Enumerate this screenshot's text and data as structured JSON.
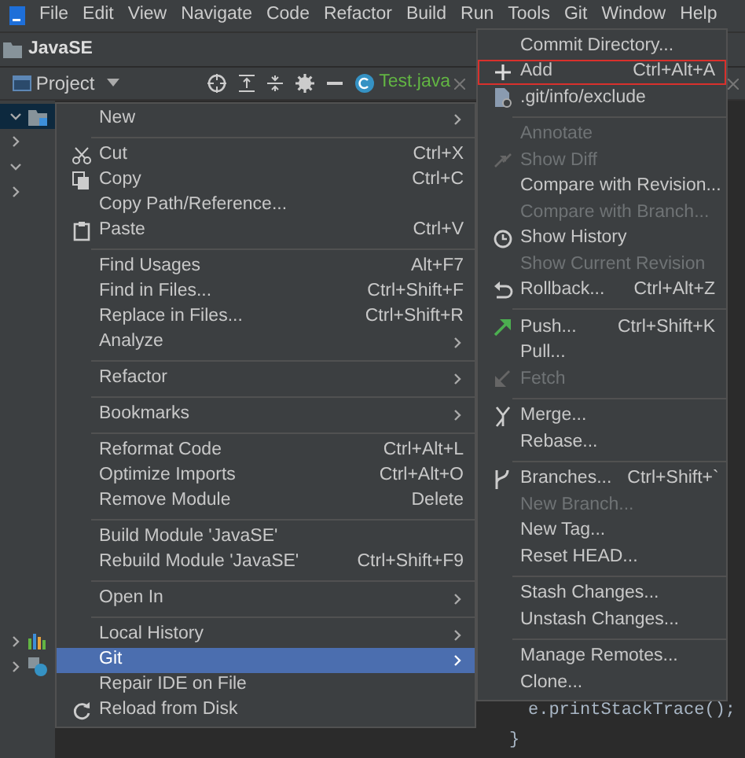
{
  "menu_bar": [
    "File",
    "Edit",
    "View",
    "Navigate",
    "Code",
    "Refactor",
    "Build",
    "Run",
    "Tools",
    "Git",
    "Window",
    "Help"
  ],
  "project_title": "JavaSE",
  "tool_window": {
    "title": "Project",
    "tab": "Test.java"
  },
  "tree_top": [
    {
      "expanded": true,
      "selected": true
    },
    {
      "expanded": false,
      "selected": false
    },
    {
      "expanded": true,
      "selected": false
    },
    {
      "expanded": false,
      "selected": false
    }
  ],
  "tree_bottom": [
    {
      "expanded": false,
      "selected": false
    },
    {
      "expanded": false,
      "selected": false
    }
  ],
  "context_menu": [
    {
      "kind": "item",
      "label": "New",
      "submenu": true
    },
    {
      "kind": "separator"
    },
    {
      "kind": "item",
      "label": "Cut",
      "shortcut": "Ctrl+X"
    },
    {
      "kind": "item",
      "label": "Copy",
      "shortcut": "Ctrl+C"
    },
    {
      "kind": "item",
      "label": "Copy Path/Reference..."
    },
    {
      "kind": "item",
      "label": "Paste",
      "shortcut": "Ctrl+V"
    },
    {
      "kind": "separator"
    },
    {
      "kind": "item",
      "label": "Find Usages",
      "shortcut": "Alt+F7"
    },
    {
      "kind": "item",
      "label": "Find in Files...",
      "shortcut": "Ctrl+Shift+F"
    },
    {
      "kind": "item",
      "label": "Replace in Files...",
      "shortcut": "Ctrl+Shift+R"
    },
    {
      "kind": "item",
      "label": "Analyze",
      "submenu": true
    },
    {
      "kind": "separator"
    },
    {
      "kind": "item",
      "label": "Refactor",
      "submenu": true
    },
    {
      "kind": "separator"
    },
    {
      "kind": "item",
      "label": "Bookmarks",
      "submenu": true
    },
    {
      "kind": "separator"
    },
    {
      "kind": "item",
      "label": "Reformat Code",
      "shortcut": "Ctrl+Alt+L"
    },
    {
      "kind": "item",
      "label": "Optimize Imports",
      "shortcut": "Ctrl+Alt+O"
    },
    {
      "kind": "item",
      "label": "Remove Module",
      "shortcut": "Delete"
    },
    {
      "kind": "separator"
    },
    {
      "kind": "item",
      "label": "Build Module 'JavaSE'"
    },
    {
      "kind": "item",
      "label": "Rebuild Module 'JavaSE'",
      "shortcut": "Ctrl+Shift+F9"
    },
    {
      "kind": "separator"
    },
    {
      "kind": "item",
      "label": "Open In",
      "submenu": true
    },
    {
      "kind": "separator"
    },
    {
      "kind": "item",
      "label": "Local History",
      "submenu": true
    },
    {
      "kind": "item",
      "label": "Git",
      "submenu": true,
      "selected": true
    },
    {
      "kind": "item",
      "label": "Repair IDE on File"
    },
    {
      "kind": "item",
      "label": "Reload from Disk"
    }
  ],
  "git_submenu": [
    {
      "kind": "item",
      "label": "Commit Directory..."
    },
    {
      "kind": "item",
      "label": "Add",
      "shortcut": "Ctrl+Alt+A",
      "outlined": true
    },
    {
      "kind": "item",
      "label": ".git/info/exclude"
    },
    {
      "kind": "separator"
    },
    {
      "kind": "item",
      "label": "Annotate",
      "disabled": true
    },
    {
      "kind": "item",
      "label": "Show Diff",
      "disabled": true
    },
    {
      "kind": "item",
      "label": "Compare with Revision..."
    },
    {
      "kind": "item",
      "label": "Compare with Branch...",
      "disabled": true
    },
    {
      "kind": "item",
      "label": "Show History"
    },
    {
      "kind": "item",
      "label": "Show Current Revision",
      "disabled": true
    },
    {
      "kind": "item",
      "label": "Rollback...",
      "shortcut": "Ctrl+Alt+Z"
    },
    {
      "kind": "separator"
    },
    {
      "kind": "item",
      "label": "Push...",
      "shortcut": "Ctrl+Shift+K"
    },
    {
      "kind": "item",
      "label": "Pull..."
    },
    {
      "kind": "item",
      "label": "Fetch",
      "disabled": true
    },
    {
      "kind": "separator"
    },
    {
      "kind": "item",
      "label": "Merge..."
    },
    {
      "kind": "item",
      "label": "Rebase..."
    },
    {
      "kind": "separator"
    },
    {
      "kind": "item",
      "label": "Branches...",
      "shortcut": "Ctrl+Shift+`"
    },
    {
      "kind": "item",
      "label": "New Branch...",
      "disabled": true
    },
    {
      "kind": "item",
      "label": "New Tag..."
    },
    {
      "kind": "item",
      "label": "Reset HEAD..."
    },
    {
      "kind": "separator"
    },
    {
      "kind": "item",
      "label": "Stash Changes..."
    },
    {
      "kind": "item",
      "label": "Unstash Changes..."
    },
    {
      "kind": "separator"
    },
    {
      "kind": "item",
      "label": "Manage Remotes..."
    },
    {
      "kind": "item",
      "label": "Clone..."
    }
  ],
  "code_lines": [
    "e.printStackTrace();",
    "}"
  ]
}
